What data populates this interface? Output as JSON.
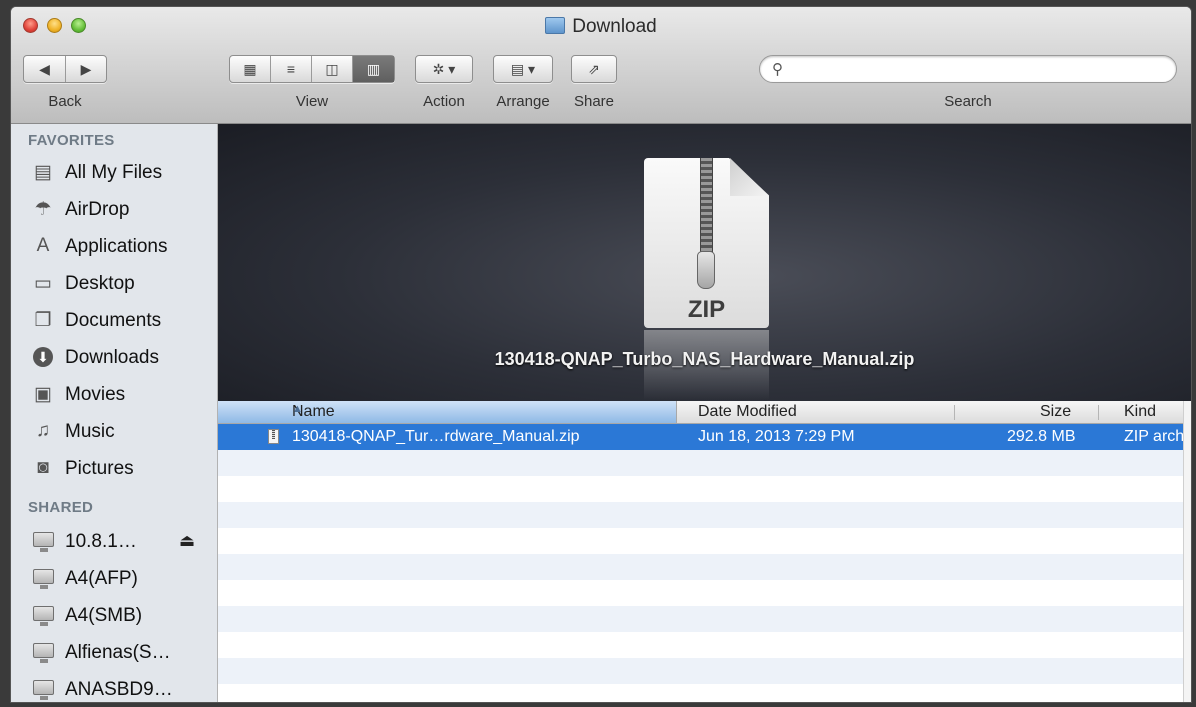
{
  "window": {
    "title": "Download"
  },
  "toolbar": {
    "back_label": "Back",
    "view_label": "View",
    "action_label": "Action",
    "arrange_label": "Arrange",
    "share_label": "Share",
    "search_label": "Search",
    "search_value": ""
  },
  "sidebar": {
    "favorites_title": "FAVORITES",
    "favorites": [
      {
        "label": "All My Files",
        "icon": "all-my-files-icon"
      },
      {
        "label": "AirDrop",
        "icon": "airdrop-icon"
      },
      {
        "label": "Applications",
        "icon": "applications-icon"
      },
      {
        "label": "Desktop",
        "icon": "desktop-icon"
      },
      {
        "label": "Documents",
        "icon": "documents-icon"
      },
      {
        "label": "Downloads",
        "icon": "downloads-icon"
      },
      {
        "label": "Movies",
        "icon": "movies-icon"
      },
      {
        "label": "Music",
        "icon": "music-icon"
      },
      {
        "label": "Pictures",
        "icon": "pictures-icon"
      }
    ],
    "shared_title": "SHARED",
    "shared": [
      {
        "label": "10.8.1…",
        "icon": "network-computer-icon",
        "eject": "⏏"
      },
      {
        "label": "A4(AFP)",
        "icon": "network-computer-icon"
      },
      {
        "label": "A4(SMB)",
        "icon": "network-computer-icon"
      },
      {
        "label": "Alfienas(S…",
        "icon": "network-computer-icon"
      },
      {
        "label": "ANASBD9…",
        "icon": "network-computer-icon"
      }
    ]
  },
  "preview": {
    "file_name": "130418-QNAP_Turbo_NAS_Hardware_Manual.zip",
    "icon_label": "ZIP"
  },
  "list": {
    "columns": {
      "name": "Name",
      "date": "Date Modified",
      "size": "Size",
      "kind": "Kind"
    },
    "rows": [
      {
        "name": "130418-QNAP_Tur…rdware_Manual.zip",
        "date": "Jun 18, 2013 7:29 PM",
        "size": "292.8 MB",
        "kind": "ZIP arch",
        "selected": true
      }
    ]
  },
  "colors": {
    "selection": "#2b78d6",
    "sidebar_bg": "#e2e6eb",
    "section_title": "#6f7b86"
  }
}
